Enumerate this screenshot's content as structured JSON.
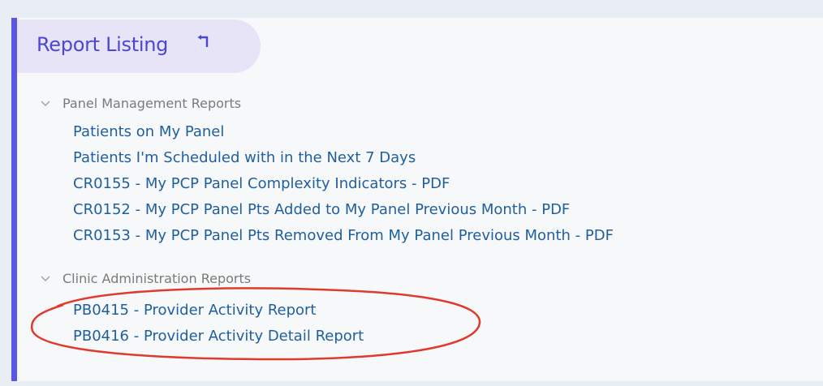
{
  "report_listing": {
    "title": "Report Listing",
    "back_icon": "back-arrow-icon"
  },
  "sections": [
    {
      "label": "Panel Management Reports",
      "icon": "chevron-down-icon",
      "reports": [
        "Patients on My Panel",
        "Patients I'm Scheduled with in the Next 7 Days",
        "CR0155 - My PCP Panel Complexity Indicators - PDF",
        "CR0152 - My PCP Panel Pts Added to My Panel Previous Month - PDF",
        "CR0153 - My PCP Panel Pts Removed From My Panel Previous Month - PDF"
      ]
    },
    {
      "label": "Clinic Administration Reports",
      "icon": "chevron-down-icon",
      "reports": [
        "PB0415 - Provider Activity Report",
        "PB0416 - Provider Activity Detail Report"
      ]
    }
  ],
  "colors": {
    "accent": "#5a57e6",
    "title": "#4b47d4",
    "link": "#1f5f9e",
    "annotation": "#e03a2e"
  }
}
